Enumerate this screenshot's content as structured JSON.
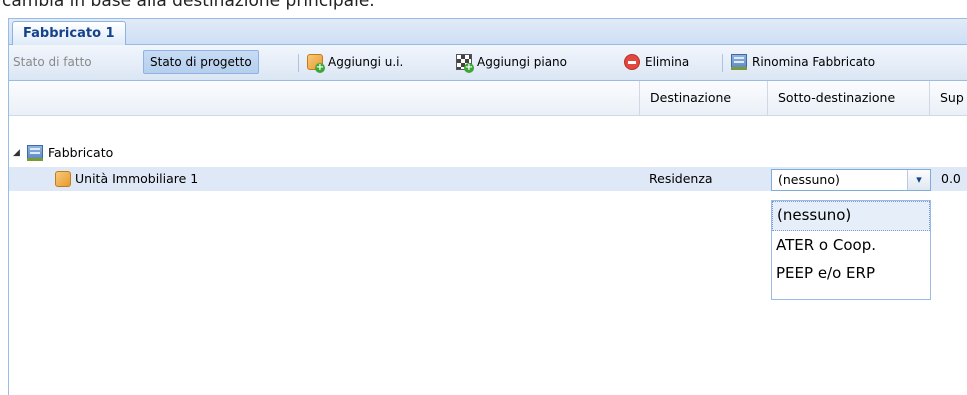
{
  "caption_cut": "cambia in base alla destinazione principale.",
  "tab": {
    "label": "Fabbricato 1"
  },
  "toolbar": {
    "stato_fatto": "Stato di fatto",
    "stato_progetto": "Stato di progetto",
    "aggiungi_ui": "Aggiungi u.i.",
    "aggiungi_piano": "Aggiungi piano",
    "elimina": "Elimina",
    "rinomina": "Rinomina Fabbricato"
  },
  "columns": [
    "",
    "Destinazione",
    "Sotto-destinazione",
    "Sup"
  ],
  "tree": {
    "root": "Fabbricato",
    "child": {
      "label": "Unità Immobiliare 1",
      "destinazione": "Residenza",
      "sotto_destinazione": "(nessuno)",
      "sup": "0.0"
    }
  },
  "dropdown": {
    "options": [
      "(nessuno)",
      "ATER o Coop.",
      "PEEP e/o ERP"
    ],
    "selected_index": 0
  },
  "icons": {
    "add_ui": "box-add-icon",
    "add_floor": "chessboard-add-icon",
    "delete": "delete-circle-icon",
    "building": "building-icon",
    "unit": "box-icon"
  },
  "colors": {
    "panel_border": "#99bbe8",
    "tab_text": "#15428b",
    "selected_row": "#dfe8f6"
  }
}
